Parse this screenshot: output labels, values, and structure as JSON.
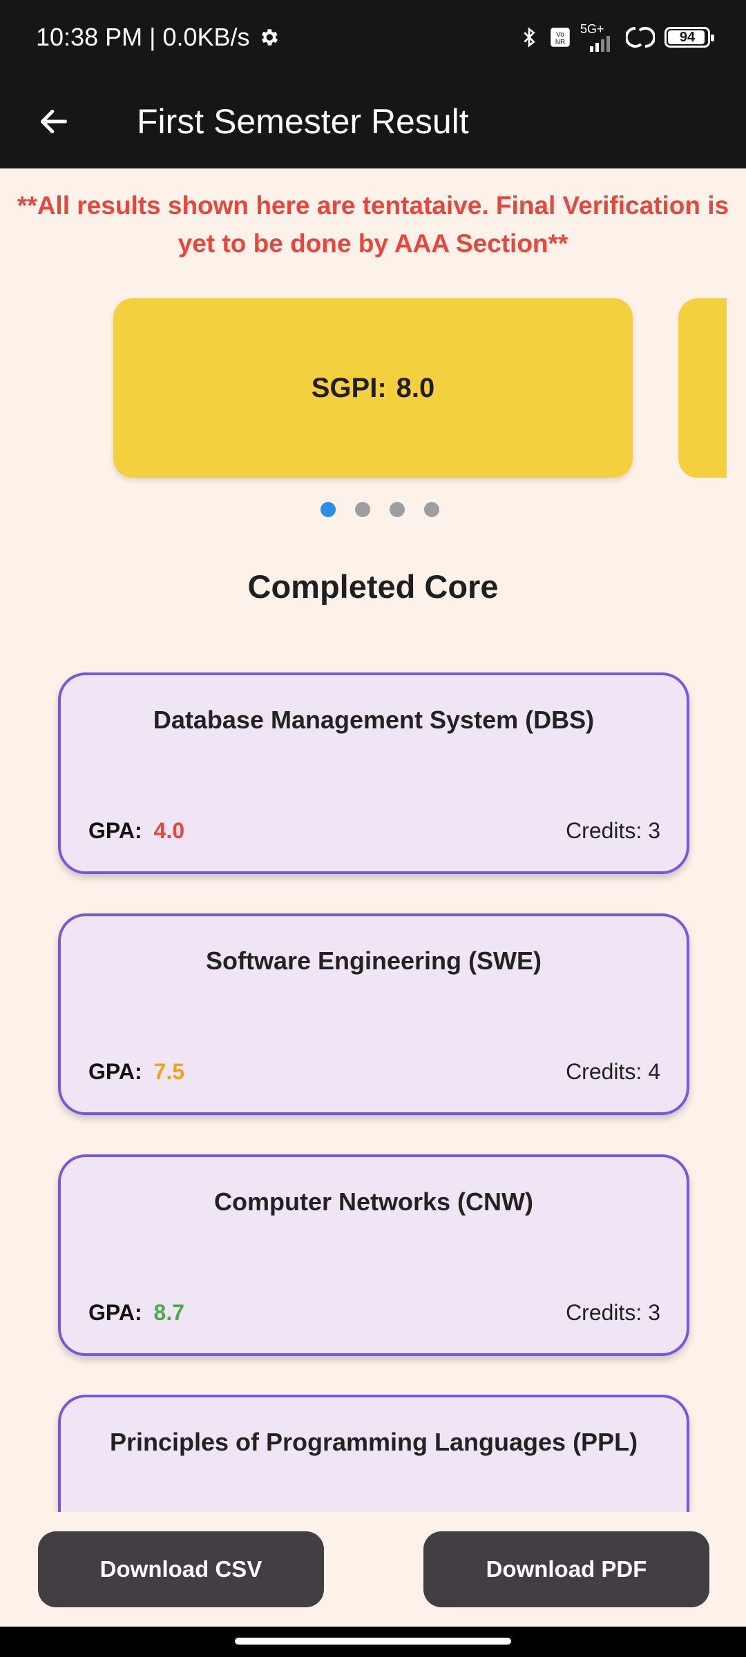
{
  "status_bar": {
    "time_speed": "10:38 PM | 0.0KB/s",
    "network": "5G+",
    "battery": "94",
    "battery_level": 0.94
  },
  "app_bar": {
    "title": "First Semester Result"
  },
  "warning_text": "**All results shown here are tentataive. Final Verification is yet to be done by AAA Section**",
  "carousel": {
    "card_label": "SGPI:",
    "card_value": "8.0",
    "page_count": 4,
    "active_index": 0
  },
  "section_title": "Completed Core",
  "courses": [
    {
      "name": "Database Management System (DBS)",
      "gpa_label": "GPA:",
      "gpa": "4.0",
      "gpa_color": "#e5473d",
      "credits": "Credits: 3"
    },
    {
      "name": "Software Engineering (SWE)",
      "gpa_label": "GPA:",
      "gpa": "7.5",
      "gpa_color": "#f0a416",
      "credits": "Credits: 4"
    },
    {
      "name": "Computer Networks (CNW)",
      "gpa_label": "GPA:",
      "gpa": "8.7",
      "gpa_color": "#48ab4a",
      "credits": "Credits: 3"
    },
    {
      "name": "Principles of Programming Languages (PPL)"
    }
  ],
  "buttons": {
    "csv": "Download CSV",
    "pdf": "Download PDF"
  }
}
